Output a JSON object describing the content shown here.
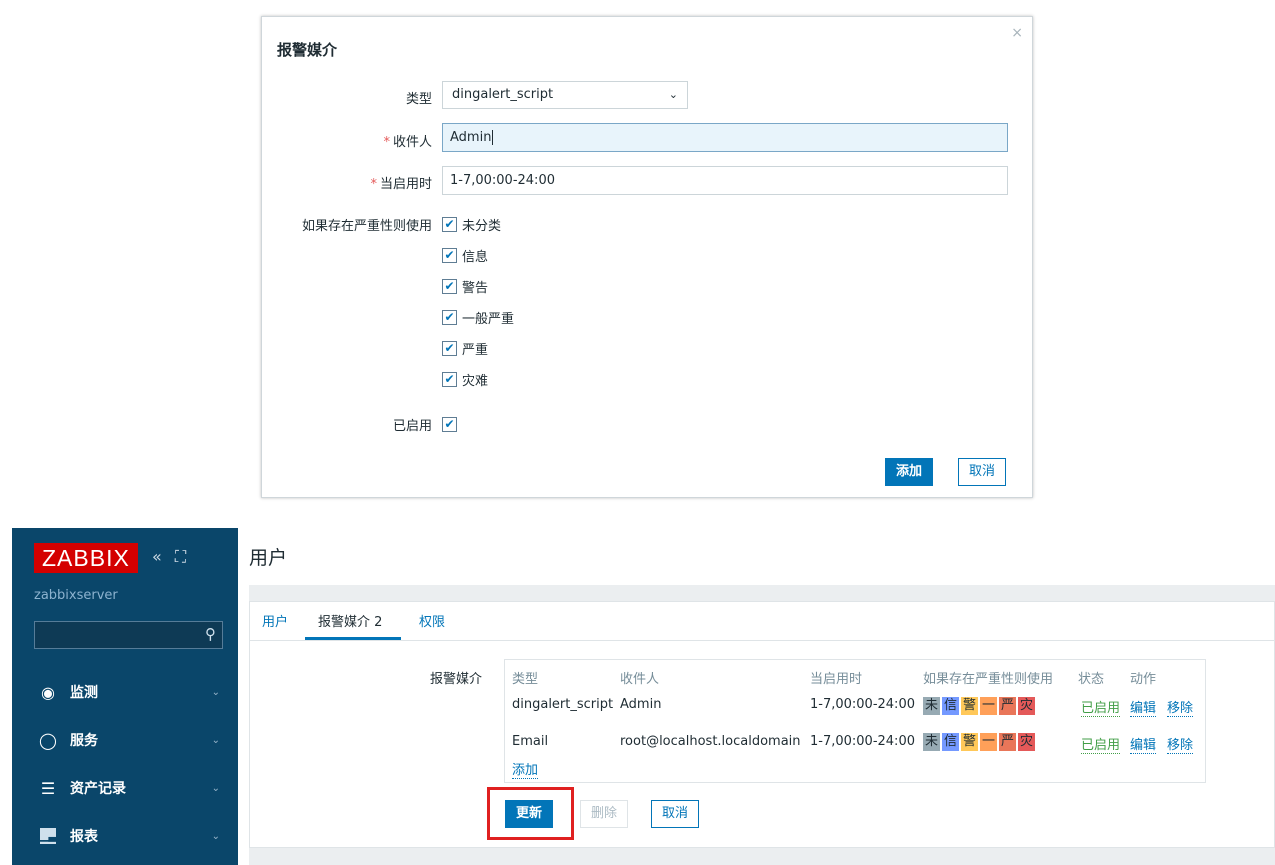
{
  "modal": {
    "title": "报警媒介",
    "close_glyph": "×",
    "type_label": "类型",
    "type_value": "dingalert_script",
    "sendto_label": "收件人",
    "sendto_value": "Admin",
    "when_active_label": "当启用时",
    "when_active_value": "1-7,00:00-24:00",
    "severity_label": "如果存在严重性则使用",
    "severities": [
      "未分类",
      "信息",
      "警告",
      "一般严重",
      "严重",
      "灾难"
    ],
    "enabled_label": "已启用",
    "add_button": "添加",
    "cancel_button": "取消",
    "required_mark": "*"
  },
  "sidebar": {
    "logo": "ZABBIX",
    "collapse_glyph": "«",
    "kiosk_glyph": "⛶",
    "server_name": "zabbixserver",
    "search_value": "",
    "items": [
      {
        "label": "监测",
        "icon": "eye-icon"
      },
      {
        "label": "服务",
        "icon": "clock-icon"
      },
      {
        "label": "资产记录",
        "icon": "list-icon"
      },
      {
        "label": "报表",
        "icon": "bar-chart-icon"
      }
    ]
  },
  "page": {
    "title": "用户",
    "tabs": [
      "用户",
      "报警媒介 2",
      "权限"
    ],
    "media_label": "报警媒介",
    "columns": [
      "类型",
      "收件人",
      "当启用时",
      "如果存在严重性则使用",
      "状态",
      "动作"
    ],
    "rows": [
      {
        "type": "dingalert_script",
        "sendto": "Admin",
        "when": "1-7,00:00-24:00",
        "status": "已启用",
        "edit": "编辑",
        "remove": "移除"
      },
      {
        "type": "Email",
        "sendto": "root@localhost.localdomain",
        "when": "1-7,00:00-24:00",
        "status": "已启用",
        "edit": "编辑",
        "remove": "移除"
      }
    ],
    "severity_abbr": [
      "未",
      "信",
      "警",
      "一",
      "严",
      "灾"
    ],
    "severity_colors": [
      "#97aab3",
      "#7499ff",
      "#ffc859",
      "#ffa059",
      "#e97659",
      "#e45959"
    ],
    "add_link": "添加",
    "update_button": "更新",
    "delete_button": "删除",
    "cancel_button": "取消"
  }
}
